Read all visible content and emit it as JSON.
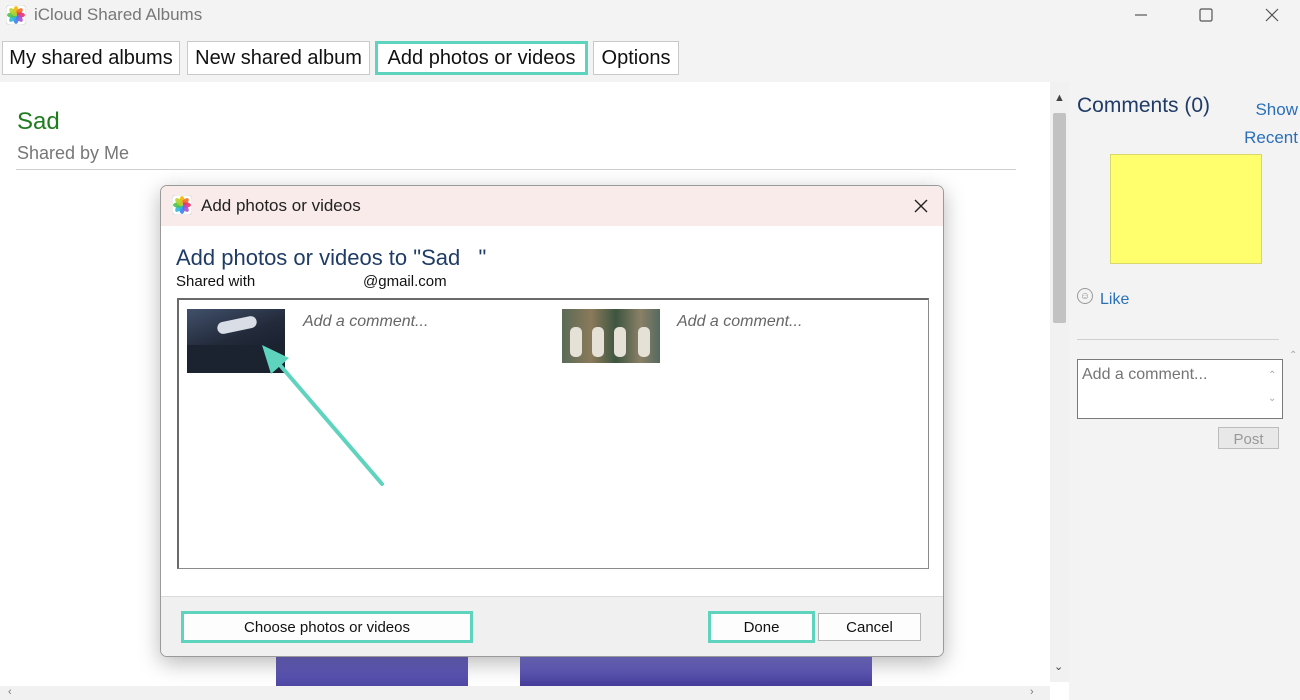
{
  "window": {
    "title": "iCloud Shared Albums",
    "icon": "photos-icon",
    "controls": [
      "minimize-icon",
      "maximize-icon",
      "close-icon"
    ]
  },
  "toolbar": {
    "my_shared_albums": "My shared albums",
    "new_shared_album": "New shared album",
    "add_photos": "Add photos or videos",
    "options": "Options",
    "highlight_color": "#5ed3bd"
  },
  "album": {
    "title": "Sad",
    "subtitle": "Shared by Me"
  },
  "comments_pane": {
    "title": "Comments (0)",
    "show": "Show",
    "recent": "Recent",
    "like": "Like",
    "add_comment_placeholder": "Add a comment...",
    "post": "Post",
    "sticky_color": "#ffff6e"
  },
  "dialog": {
    "title": "Add photos or videos",
    "heading": "Add photos or videos to \"Sad   \"",
    "shared_with_label": "Shared with",
    "shared_with_email": "@gmail.com",
    "items": [
      {
        "thumb": "celebration-photo",
        "comment_placeholder": "Add a comment..."
      },
      {
        "thumb": "group-photo",
        "comment_placeholder": "Add a comment..."
      }
    ],
    "choose_button": "Choose photos or videos",
    "done_button": "Done",
    "cancel_button": "Cancel",
    "annotation_arrow_color": "#5ed3bd"
  }
}
